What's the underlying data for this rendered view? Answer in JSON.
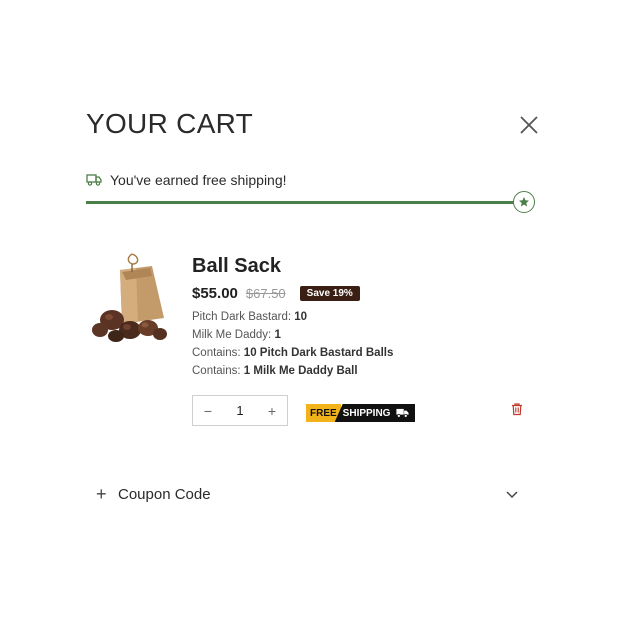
{
  "cart": {
    "title": "YOUR CART",
    "shipping_message": "You've earned free shipping!",
    "shipping_progress": 1.0,
    "accent_color": "#4c7f48"
  },
  "item": {
    "name": "Ball Sack",
    "price": "$55.00",
    "compare_price": "$67.50",
    "save_badge": "Save 19%",
    "properties": [
      {
        "label": "Pitch Dark Bastard:",
        "value": "10"
      },
      {
        "label": "Milk Me Daddy:",
        "value": "1"
      },
      {
        "label": "Contains:",
        "value": "10 Pitch Dark Bastard Balls"
      },
      {
        "label": "Contains:",
        "value": "1 Milk Me Daddy Ball"
      }
    ],
    "quantity": "1",
    "qty_minus": "−",
    "qty_plus": "+",
    "free_label": "FREE",
    "shipping_label": "SHIPPING"
  },
  "coupon": {
    "plus": "+",
    "label": "Coupon Code"
  },
  "icons": {
    "close": "close-icon",
    "truck": "truck-icon",
    "star": "star-icon",
    "trash": "trash-icon",
    "chevron": "chevron-down-icon"
  }
}
